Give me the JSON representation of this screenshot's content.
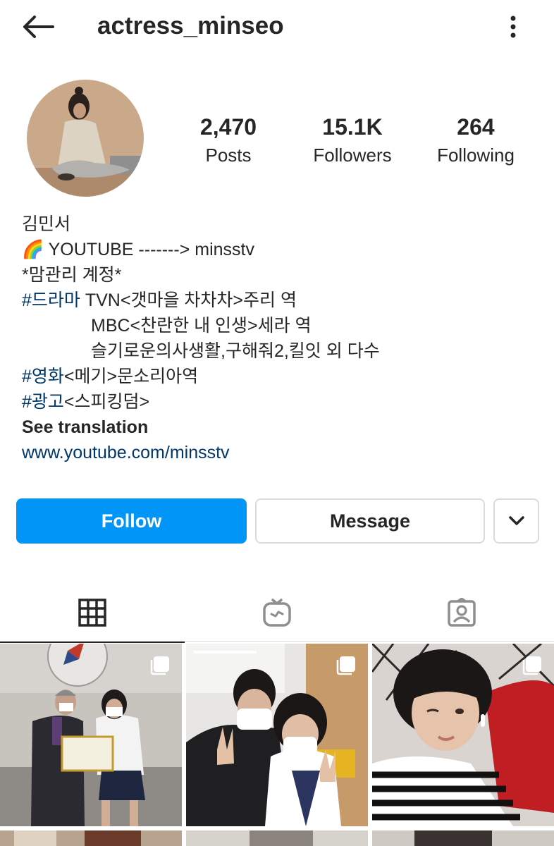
{
  "header": {
    "username": "actress_minseo"
  },
  "stats": [
    {
      "value": "2,470",
      "label": "Posts"
    },
    {
      "value": "15.1K",
      "label": "Followers"
    },
    {
      "value": "264",
      "label": "Following"
    }
  ],
  "bio": {
    "name": "김민서",
    "youtube_emoji": "🌈",
    "youtube_line": " YOUTUBE -------> minsstv",
    "managed_line": "*맘관리 계정*",
    "drama_tag": "#드라마",
    "drama_line1": " TVN<갯마을 차차차>주리 역",
    "drama_line2": "MBC<찬란한 내 인생>세라 역",
    "drama_line3": "슬기로운의사생활,구해줘2,킬잇 외 다수",
    "movie_tag": "#영화",
    "movie_line": "<메기>문소리아역",
    "ad_tag": "#광고",
    "ad_line": "<스피킹덤>",
    "see_translation": "See translation",
    "website": "www.youtube.com/minsstv"
  },
  "actions": {
    "follow_label": "Follow",
    "message_label": "Message"
  },
  "tabs": [
    {
      "icon": "grid-icon",
      "active": true
    },
    {
      "icon": "igtv-icon",
      "active": false
    },
    {
      "icon": "tagged-icon",
      "active": false
    }
  ],
  "colors": {
    "accent": "#0095f6",
    "link": "#00376b",
    "text": "#262626",
    "border": "#dbdbdb"
  }
}
